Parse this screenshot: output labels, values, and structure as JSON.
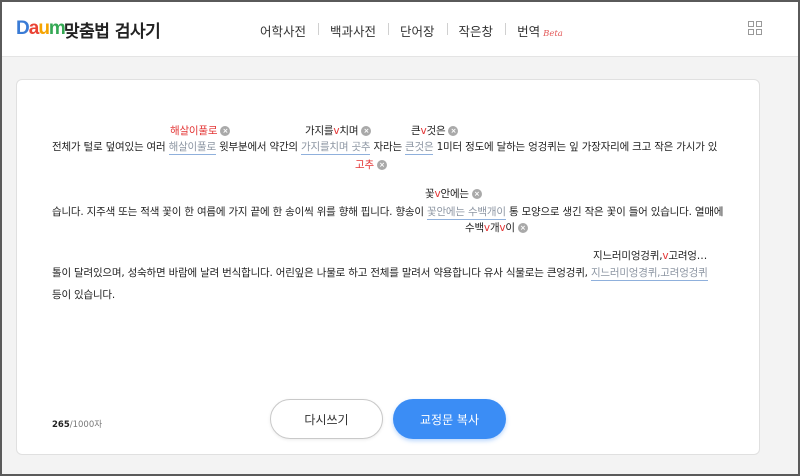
{
  "header": {
    "logo": {
      "d": "D",
      "a": "a",
      "u": "u",
      "m": "m"
    },
    "service_title": "맞춤법 검사기",
    "nav": [
      {
        "label": "어학사전"
      },
      {
        "label": "백과사전"
      },
      {
        "label": "단어장"
      },
      {
        "label": "작은창"
      },
      {
        "label": "번역",
        "badge": "Beta"
      }
    ]
  },
  "document": {
    "line1": {
      "t1": "전체가 털로 덮여있는 여러 ",
      "e1": "해살이풀로",
      "t2": " 윗부분에서 약간의 ",
      "e2": "가지를치며 곳추",
      "t3": " 자라는 ",
      "e3": "큰것은",
      "t4": " 1미터 정도에 달하는 엉겅퀴는 잎 가장자리에 크고 작은 가시가 있"
    },
    "line2": {
      "t1": "습니다. 지주색 또는 적색 꽃이 한 여름에 가지 끝에 한 송이씩 위를 향해 핍니다. 향송이 ",
      "e1": "꽃안에는 수백개이",
      "t2": " 통 모양으로 생긴 작은 꽃이 들어 있습니다. 열매에"
    },
    "line3": {
      "t1": "톨이 달려있으며, 성숙하면 바람에 날려 번식합니다. 어린잎은 나물로 하고 전체를 말려서 약용합니다 유사 식물로는 큰엉겅퀴, ",
      "e1": "지느러미엉경퀴,고려엉겅퀴"
    },
    "line4": "등이 있습니다.",
    "suggestions": {
      "s1": "해살이풀로",
      "s2a": "가지를",
      "s2b": "치며",
      "s2c": "고추",
      "s3a": "큰",
      "s3b": "것은",
      "s4a": "꽃",
      "s4b": "안에는",
      "s4c": "수백",
      "s4d": "개",
      "s4e": "이",
      "s5a": "지느러미엉겅퀴,",
      "s5b": "고려엉…"
    },
    "close_glyph": "×",
    "caret_glyph": "v"
  },
  "counter": {
    "current": "265",
    "max": "/1000자"
  },
  "actions": {
    "reset_label": "다시쓰기",
    "copy_label": "교정문 복사"
  },
  "colors": {
    "accent": "#3b8df5",
    "error": "#e33535",
    "underline": "#8fb0dc"
  }
}
